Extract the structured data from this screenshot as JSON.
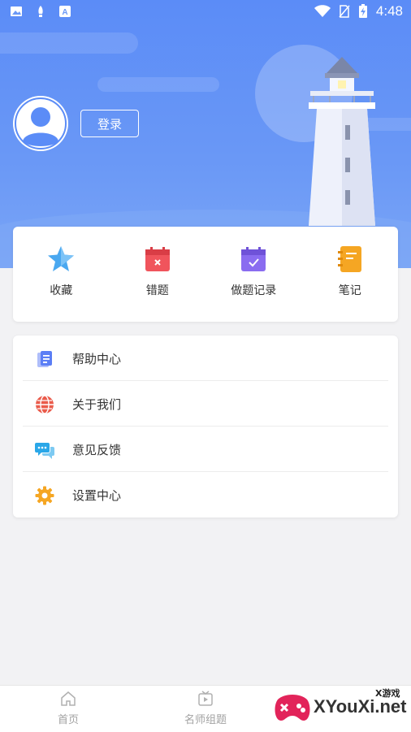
{
  "status_bar": {
    "time": "4:48"
  },
  "profile": {
    "login_label": "登录"
  },
  "quick_actions": [
    {
      "label": "收藏",
      "icon": "star-icon",
      "color": "#4aa8f0"
    },
    {
      "label": "错题",
      "icon": "error-calendar-icon",
      "color": "#f0545c"
    },
    {
      "label": "做题记录",
      "icon": "check-calendar-icon",
      "color": "#8a6cf0"
    },
    {
      "label": "笔记",
      "icon": "notebook-icon",
      "color": "#f5a623"
    }
  ],
  "menu": [
    {
      "label": "帮助中心",
      "icon": "help-document-icon",
      "color": "#5b7ef5"
    },
    {
      "label": "关于我们",
      "icon": "globe-icon",
      "color": "#ea5b4b"
    },
    {
      "label": "意见反馈",
      "icon": "chat-bubbles-icon",
      "color": "#2aa7e8"
    },
    {
      "label": "设置中心",
      "icon": "gear-icon",
      "color": "#f5a623"
    }
  ],
  "tabs": [
    {
      "label": "首页",
      "icon": "home-icon"
    },
    {
      "label": "名师组题",
      "icon": "video-icon"
    }
  ],
  "watermark": {
    "brand": "XYouXi.net",
    "tag": "X游戏"
  },
  "colors": {
    "hero": "#5b8cf7",
    "tab_text": "#a2a2a2"
  }
}
